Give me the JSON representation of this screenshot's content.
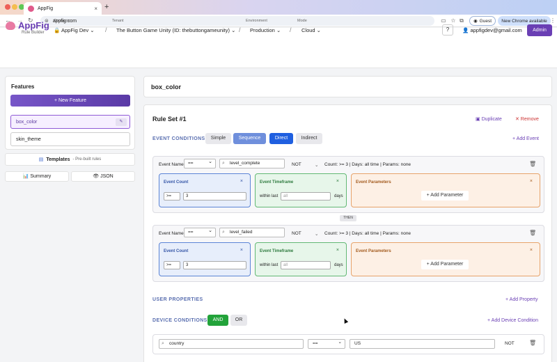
{
  "browser": {
    "tab_title": "AppFig",
    "new_tab": "+",
    "url": "appfig.com",
    "guest_label": "Guest",
    "new_chrome_label": "New Chrome available",
    "close": "×"
  },
  "header": {
    "brand": "AppFig",
    "brand_sub": "Rule Builder",
    "company_label": "Company",
    "company_value": "🔒 AppFig Dev ⌄",
    "tenant_label": "Tenant",
    "tenant_value": "The Button Game Unity (ID: thebuttongameunity) ⌄",
    "environment_label": "Environment",
    "environment_value": "Production ⌄",
    "mode_label": "Mode",
    "mode_value": "Cloud ⌄",
    "separator": "/",
    "help": "?",
    "user_email": "appfigdev@gmail.com",
    "admin_label": "Admin"
  },
  "sidebar": {
    "title": "Features",
    "new_feature": "+ New Feature",
    "features": [
      "box_color",
      "skin_theme"
    ],
    "templates_label": "Templates",
    "templates_sub": "- Pre-built rules",
    "summary_label": "📊 Summary",
    "json_label": "👁 JSON"
  },
  "main": {
    "feature_name": "box_color",
    "ruleset_title": "Rule Set #1",
    "duplicate": "Duplicate",
    "remove": "✕ Remove",
    "event_conditions": "EVENT CONDITIONS",
    "event_modes": [
      "Simple",
      "Sequence",
      "Direct",
      "Indirect"
    ],
    "add_event": "+ Add Event",
    "event_name_label": "Event Name",
    "not_label": "NOT",
    "then_label": "THEN",
    "events": [
      {
        "op": "==",
        "name": "level_complete",
        "summary": "Count: >= 3   |   Days: all time   |   Params: none",
        "count_op": ">=",
        "count_val": "3",
        "days_placeholder": "all"
      },
      {
        "op": "==",
        "name": "level_failed",
        "summary": "Count: >= 3   |   Days: all time   |   Params: none",
        "count_op": ">=",
        "count_val": "3",
        "days_placeholder": "all"
      }
    ],
    "event_count_title": "Event Count",
    "event_timeframe_title": "Event Timeframe",
    "event_params_title": "Event Parameters",
    "within_last": "within last",
    "days": "days",
    "add_parameter": "+ Add Parameter",
    "user_properties": "USER PROPERTIES",
    "add_property": "+ Add Property",
    "device_conditions": "DEVICE CONDITIONS",
    "device_logic": [
      "AND",
      "OR"
    ],
    "add_device_condition": "+ Add Device Condition",
    "device_row": {
      "key": "country",
      "op": "==",
      "value": "US",
      "not": "NOT"
    }
  },
  "colors": {
    "accent": "#6a3fb4",
    "blue": "#1f5fe0",
    "green": "#22a33a"
  }
}
